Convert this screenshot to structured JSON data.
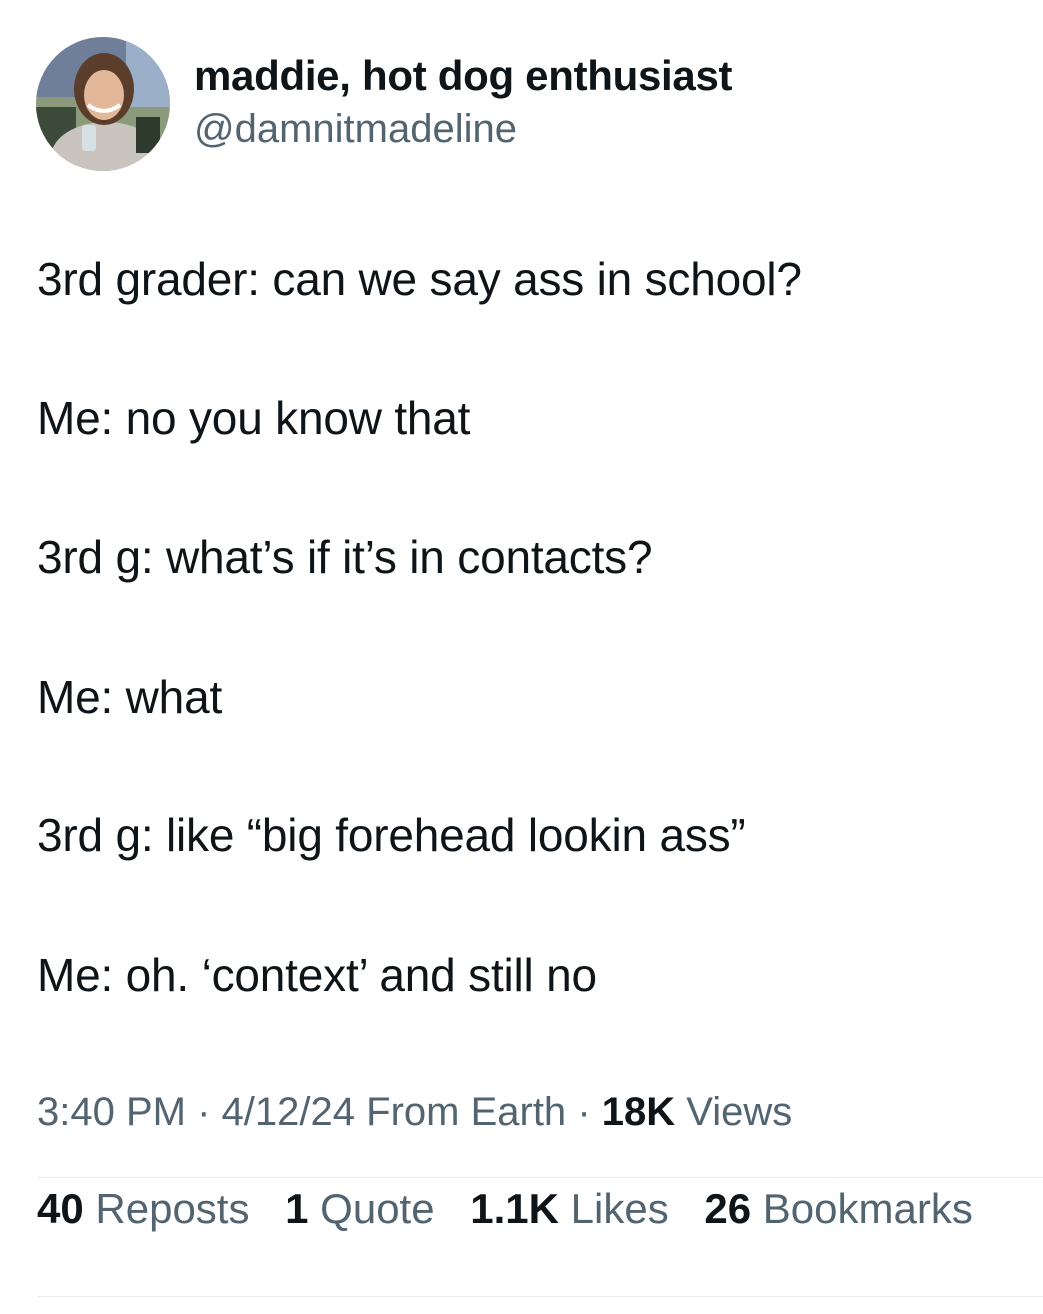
{
  "author": {
    "name": "maddie, hot dog enthusiast",
    "handle": "@damnitmadeline"
  },
  "tweet": {
    "lines": [
      "3rd grader: can we say ass in school?",
      "Me: no you know that",
      "3rd g: what’s if it’s in contacts?",
      "Me: what",
      "3rd g: like “big forehead lookin ass”",
      "Me: oh. ‘context’ and still no"
    ]
  },
  "meta": {
    "time": "3:40 PM",
    "sep1": "·",
    "date": "4/12/24",
    "source": "From Earth",
    "sep2": "·",
    "views_count": "18K",
    "views_label": "Views"
  },
  "stats": {
    "reposts_count": "40",
    "reposts_label": "Reposts",
    "quotes_count": "1",
    "quotes_label": "Quote",
    "likes_count": "1.1K",
    "likes_label": "Likes",
    "bookmarks_count": "26",
    "bookmarks_label": "Bookmarks"
  },
  "colors": {
    "text_primary": "#0f1419",
    "text_secondary": "#536471",
    "divider": "#e6ecf0"
  }
}
